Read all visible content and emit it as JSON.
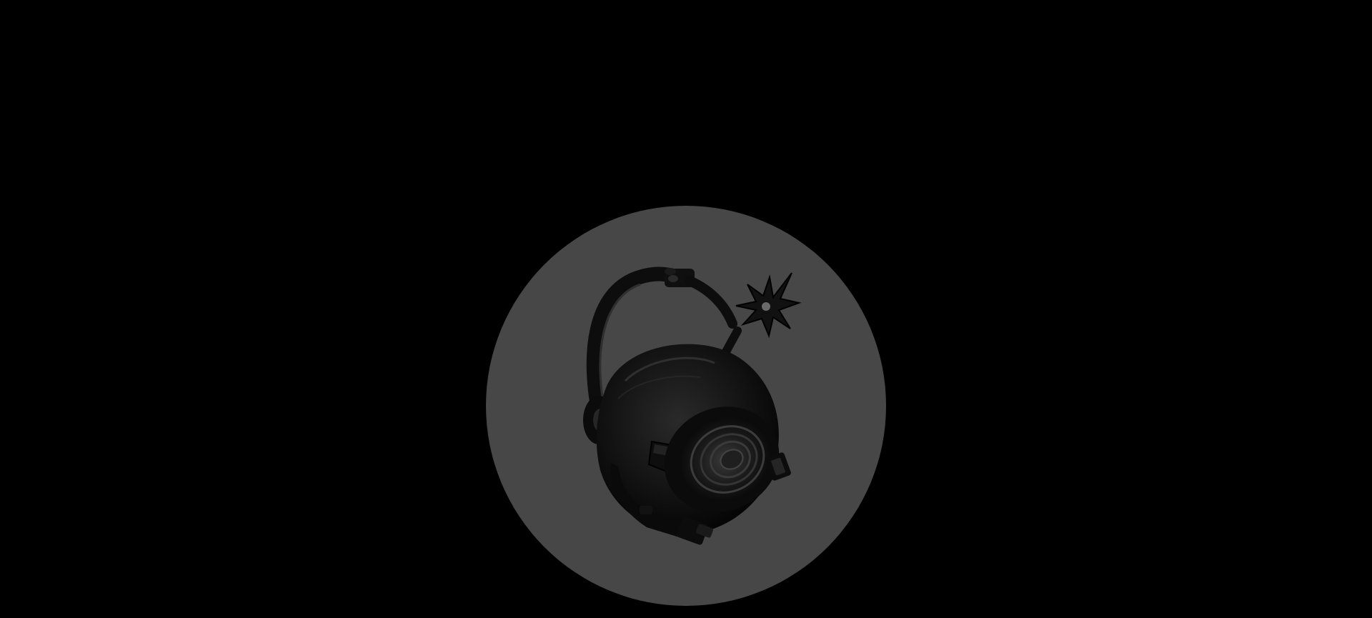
{
  "page": {
    "background_color": "#000000"
  },
  "logo": {
    "icon": "spotlight-bomb-icon",
    "disc_color": "#474747",
    "ink_color": "#0d0d0d",
    "spark_color": "#111111"
  }
}
